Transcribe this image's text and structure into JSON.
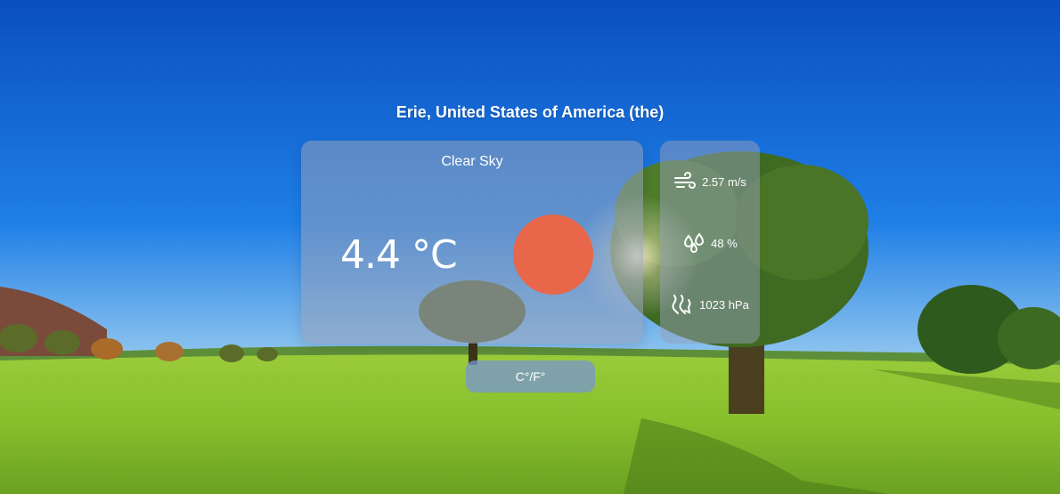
{
  "location": "Erie, United States of America (the)",
  "weather": {
    "condition": "Clear Sky",
    "temperature": "4.4 °C",
    "icon": "sun-icon",
    "icon_color": "#e8674a"
  },
  "metrics": {
    "wind": {
      "icon": "wind-icon",
      "value": "2.57 m/s"
    },
    "humidity": {
      "icon": "humidity-icon",
      "value": "48 %"
    },
    "pressure": {
      "icon": "pressure-icon",
      "value": "1023 hPa"
    }
  },
  "toggle_label": "C°/F°"
}
